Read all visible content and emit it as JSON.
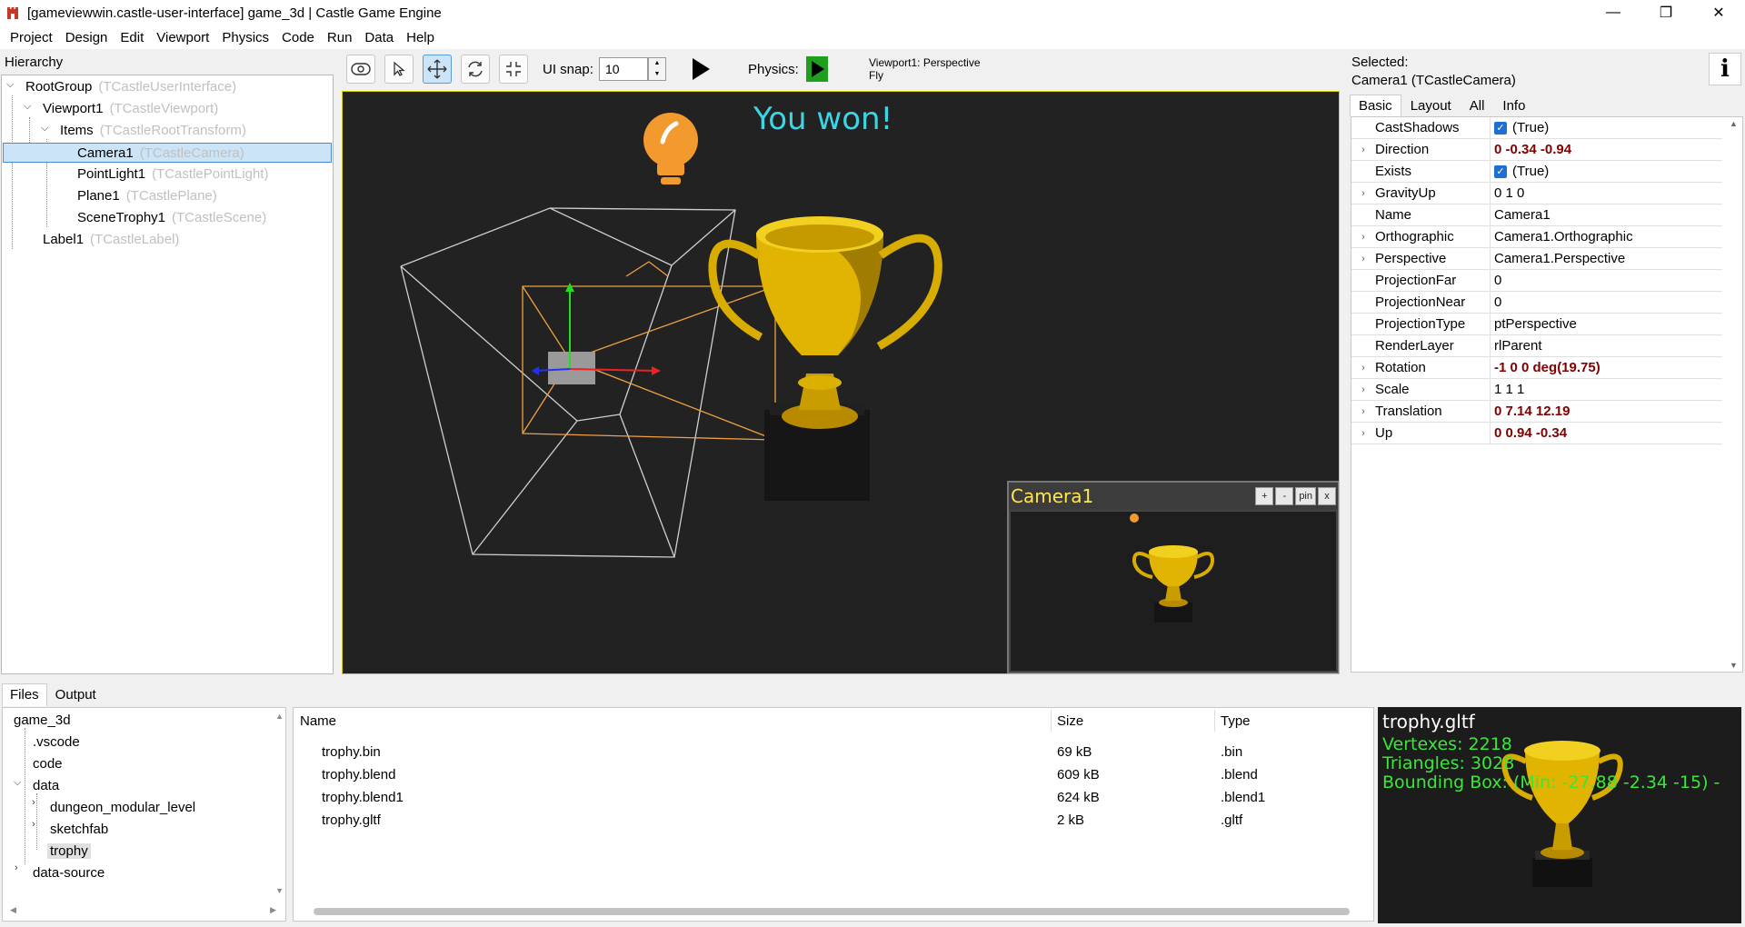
{
  "window": {
    "title": "[gameviewwin.castle-user-interface] game_3d | Castle Game Engine",
    "minimize": "—",
    "maximize": "❐",
    "close": "✕"
  },
  "menu": [
    "Project",
    "Design",
    "Edit",
    "Viewport",
    "Physics",
    "Code",
    "Run",
    "Data",
    "Help"
  ],
  "hierarchy": {
    "label": "Hierarchy",
    "items": [
      {
        "name": "RootGroup",
        "cls": "(TCastleUserInterface)"
      },
      {
        "name": "Viewport1",
        "cls": "(TCastleViewport)"
      },
      {
        "name": "Items",
        "cls": "(TCastleRootTransform)"
      },
      {
        "name": "Camera1",
        "cls": "(TCastleCamera)"
      },
      {
        "name": "PointLight1",
        "cls": "(TCastlePointLight)"
      },
      {
        "name": "Plane1",
        "cls": "(TCastlePlane)"
      },
      {
        "name": "SceneTrophy1",
        "cls": "(TCastleScene)"
      },
      {
        "name": "Label1",
        "cls": "(TCastleLabel)"
      }
    ]
  },
  "toolbar": {
    "ui_snap_label": "UI snap:",
    "ui_snap_value": "10",
    "physics_label": "Physics:",
    "viewport_info_line1": "Viewport1: Perspective",
    "viewport_info_line2": "Fly"
  },
  "viewport": {
    "label_text": "You won!",
    "label_color": "#3bd6e6",
    "camera_preview": {
      "title": "Camera1",
      "buttons": [
        "+",
        "-",
        "pin",
        "x"
      ]
    }
  },
  "inspector": {
    "selected_label": "Selected:",
    "selected_value": "Camera1 (TCastleCamera)",
    "tabs": [
      "Basic",
      "Layout",
      "All",
      "Info"
    ],
    "active_tab": "Basic",
    "properties": [
      {
        "name": "CastShadows",
        "value": "(True)",
        "checkbox": true,
        "expandable": false,
        "modified": false
      },
      {
        "name": "Direction",
        "value": "0 -0.34 -0.94",
        "expandable": true,
        "modified": true
      },
      {
        "name": "Exists",
        "value": "(True)",
        "checkbox": true,
        "expandable": false,
        "modified": false
      },
      {
        "name": "GravityUp",
        "value": "0 1 0",
        "expandable": true,
        "modified": false
      },
      {
        "name": "Name",
        "value": "Camera1",
        "expandable": false,
        "modified": false
      },
      {
        "name": "Orthographic",
        "value": "Camera1.Orthographic",
        "expandable": true,
        "modified": false
      },
      {
        "name": "Perspective",
        "value": "Camera1.Perspective",
        "expandable": true,
        "modified": false
      },
      {
        "name": "ProjectionFar",
        "value": "0",
        "expandable": false,
        "modified": false
      },
      {
        "name": "ProjectionNear",
        "value": "0",
        "expandable": false,
        "modified": false
      },
      {
        "name": "ProjectionType",
        "value": "ptPerspective",
        "expandable": false,
        "modified": false
      },
      {
        "name": "RenderLayer",
        "value": "rlParent",
        "expandable": false,
        "modified": false
      },
      {
        "name": "Rotation",
        "value": "-1 0 0 deg(19.75)",
        "expandable": true,
        "modified": true
      },
      {
        "name": "Scale",
        "value": "1 1 1",
        "expandable": true,
        "modified": false
      },
      {
        "name": "Translation",
        "value": "0 7.14 12.19",
        "expandable": true,
        "modified": true
      },
      {
        "name": "Up",
        "value": "0 0.94 -0.34",
        "expandable": true,
        "modified": true
      }
    ]
  },
  "bottom": {
    "tabs": [
      "Files",
      "Output"
    ],
    "active_tab": "Files",
    "tree": [
      {
        "name": "game_3d"
      },
      {
        "name": ".vscode"
      },
      {
        "name": "code"
      },
      {
        "name": "data"
      },
      {
        "name": "dungeon_modular_level"
      },
      {
        "name": "sketchfab"
      },
      {
        "name": "trophy"
      },
      {
        "name": "data-source"
      }
    ],
    "list": {
      "columns": [
        "Name",
        "Size",
        "Type"
      ],
      "rows": [
        {
          "name": "trophy.bin",
          "size": "69 kB",
          "type": ".bin"
        },
        {
          "name": "trophy.blend",
          "size": "609 kB",
          "type": ".blend"
        },
        {
          "name": "trophy.blend1",
          "size": "624 kB",
          "type": ".blend1"
        },
        {
          "name": "trophy.gltf",
          "size": "2 kB",
          "type": ".gltf"
        }
      ]
    },
    "preview": {
      "title": "trophy.gltf",
      "vertexes": "Vertexes: 2218",
      "triangles": "Triangles: 3028",
      "bbox": "Bounding Box: (Min: -27.88 -2.34 -15) -"
    }
  },
  "colors": {
    "accent": "#1f6fd1",
    "selection": "#cce4f7",
    "modified": "#7f0000",
    "trophy_gold": "#e0b400",
    "play_green": "#1ea01e"
  }
}
